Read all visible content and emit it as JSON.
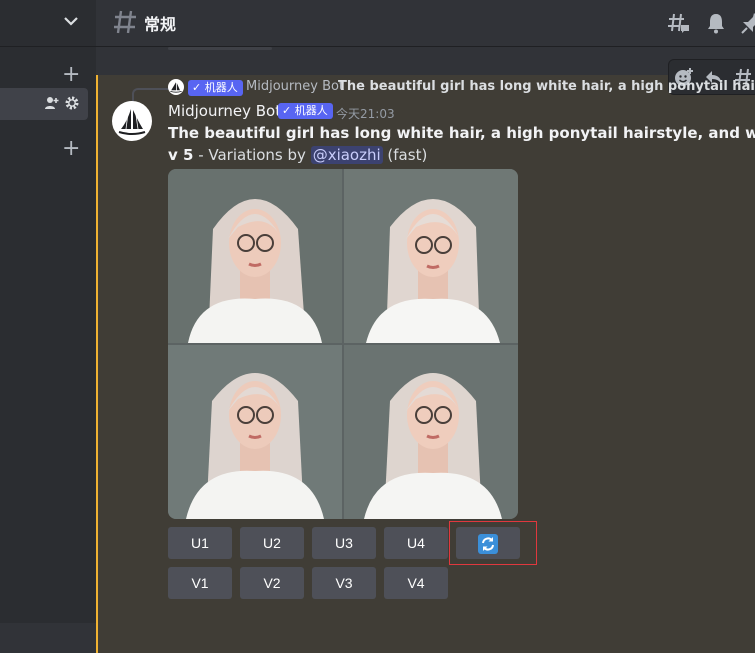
{
  "header": {
    "channel_name": "常规"
  },
  "reply": {
    "bot_badge": "✓ 机器人",
    "author": "Midjourney Bot",
    "text": "The beautiful girl has long white hair, a high ponytail hairstyle, ar"
  },
  "message": {
    "author": "Midjourney Bot",
    "bot_badge": "✓ 机器人",
    "timestamp": "今天21:03",
    "prompt": "The beautiful girl has long white hair, a high ponytail hairstyle, and wears glasses --",
    "version": "v 5",
    "variations_prefix": " - Variations by ",
    "mention": "@xiaozhi",
    "speed": " (fast)"
  },
  "buttons": {
    "upscale": [
      "U1",
      "U2",
      "U3",
      "U4"
    ],
    "variation": [
      "V1",
      "V2",
      "V3",
      "V4"
    ],
    "reroll_icon": "refresh-icon"
  },
  "colors": {
    "accent": "#5865f2",
    "highlight_bar": "#f0b232",
    "reroll": "#3b8fd9",
    "selection_box": "#e0383e"
  }
}
